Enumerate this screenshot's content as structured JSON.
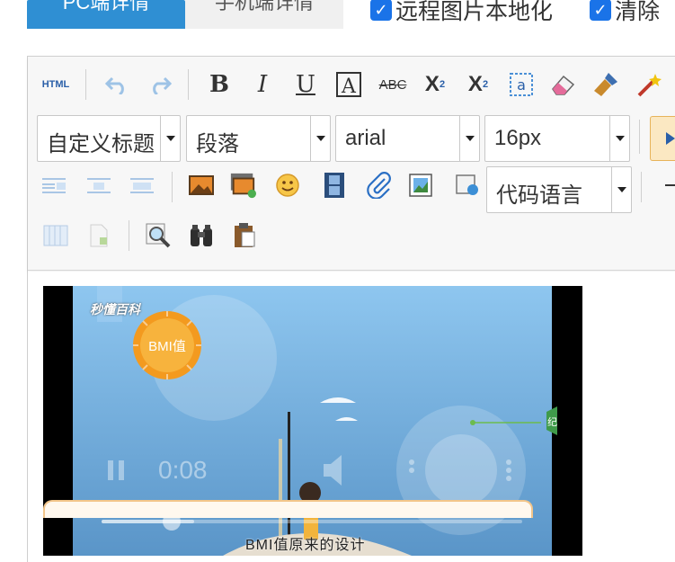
{
  "tabs": {
    "pc": "PC端详情",
    "mobile": "手机端详情"
  },
  "options": {
    "remote_images": "远程图片本地化",
    "clear": "清除"
  },
  "toolbar": {
    "html_label": "HTML",
    "heading_select": "自定义标题",
    "paragraph_select": "段落",
    "font_select": "arial",
    "size_select": "16px",
    "code_language_select": "代码语言"
  },
  "video": {
    "brand": "秒懂百科",
    "badge": "BMI值",
    "time": "0:08",
    "subtitle": "BMI值原来的设计",
    "side_tag": "纪",
    "progress": 0.22
  },
  "colors": {
    "accent": "#2f8fd3",
    "badge": "#f7a12d",
    "sky": "#7ec3ee"
  }
}
